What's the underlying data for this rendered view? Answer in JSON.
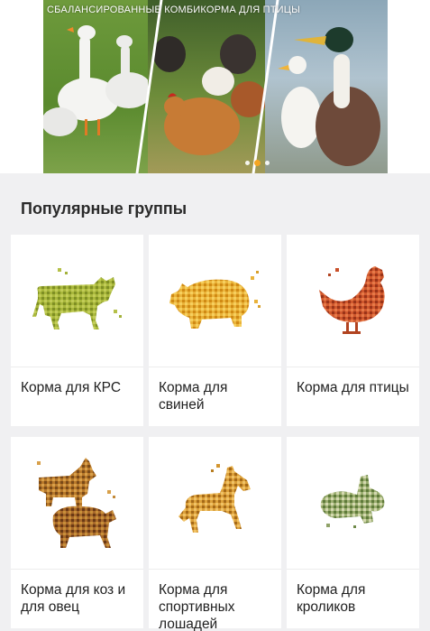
{
  "banner": {
    "caption": "СБАЛАНСИРОВАННЫЕ КОМБИКОРМА ДЛЯ ПТИЦЫ",
    "slides_count": 3,
    "active_slide": 2
  },
  "section": {
    "title": "Популярные группы"
  },
  "groups": [
    {
      "label": "Корма для КРС",
      "icon": "cow-feed-icon",
      "color": "#9fb13a"
    },
    {
      "label": "Корма для свиней",
      "icon": "pig-feed-icon",
      "color": "#e0a524"
    },
    {
      "label": "Корма для птицы",
      "icon": "hen-feed-icon",
      "color": "#c9502a"
    },
    {
      "label": "Корма для коз и для овец",
      "icon": "goat-sheep-feed-icon",
      "color": "#b7782a"
    },
    {
      "label": "Корма для спортивных лошадей",
      "icon": "horse-feed-icon",
      "color": "#d3952e"
    },
    {
      "label": "Корма для кроликов",
      "icon": "rabbit-feed-icon",
      "color": "#8fa268"
    }
  ],
  "colors": {
    "background": "#f0f0f2",
    "card": "#ffffff",
    "accent_dot": "#f5a623"
  }
}
